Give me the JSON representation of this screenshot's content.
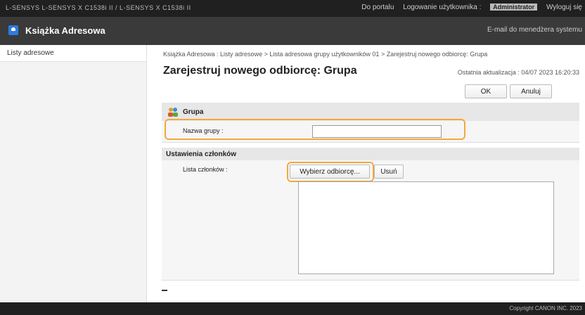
{
  "topbar": {
    "device": "L-SENSYS   L-SENSYS X C1538i II / L-SENSYS X C1538i II",
    "portal": "Do portalu",
    "login_label": "Logowanie użytkownika :",
    "user": "Administrator",
    "logout": "Wyloguj się"
  },
  "app": {
    "title": "Książka Adresowa",
    "email_admin": "E-mail do menedżera systemu"
  },
  "sidebar": {
    "items": [
      {
        "label": "Listy adresowe"
      }
    ]
  },
  "breadcrumb": {
    "items": [
      "Książka Adresowa : Listy adresowe",
      "Lista adresowa grupy użytkowników 01",
      "Zarejestruj nowego odbiorcę: Grupa"
    ],
    "separator": " > "
  },
  "page": {
    "title": "Zarejestruj nowego odbiorcę: Grupa",
    "last_update": "Ostatnia aktualizacja : 04/07 2023 16:20:33"
  },
  "buttons": {
    "ok": "OK",
    "cancel": "Anuluj"
  },
  "group_section": {
    "heading": "Grupa",
    "name_label": "Nazwa grupy :",
    "name_value": ""
  },
  "members_section": {
    "heading": "Ustawienia członków",
    "list_label": "Lista członków :",
    "pick_button": "Wybierz odbiorcę...",
    "delete_button": "Usuń",
    "members": []
  },
  "footer": {
    "copyright": "Copyright CANON INC. 2023"
  },
  "colors": {
    "highlight": "#f2a93b",
    "app_icon": "#2a7de1"
  },
  "icons": {
    "to_top": "to-top-icon",
    "group": "group-people-icon"
  }
}
